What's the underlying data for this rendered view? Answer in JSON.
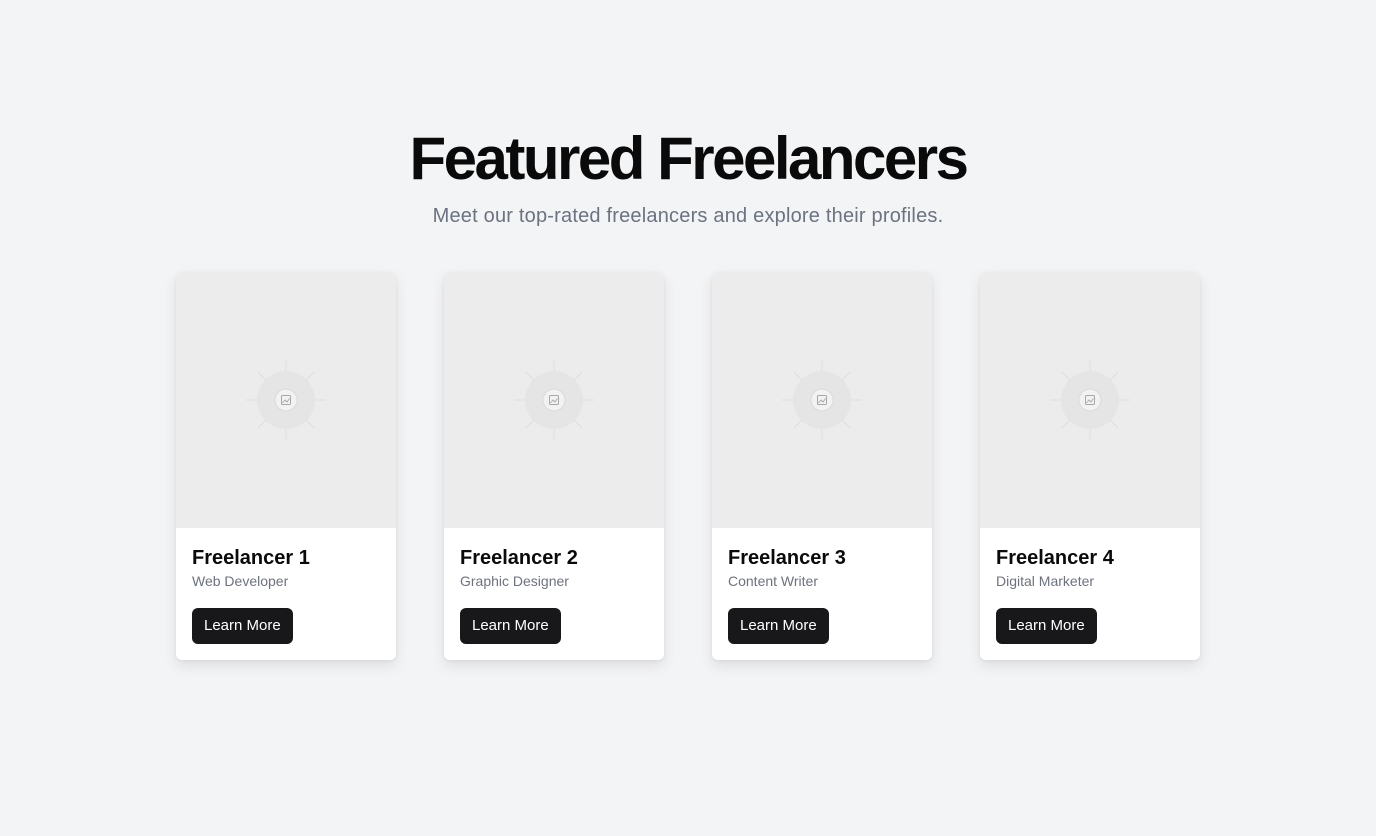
{
  "header": {
    "title": "Featured Freelancers",
    "subtitle": "Meet our top-rated freelancers and explore their profiles."
  },
  "freelancers": [
    {
      "name": "Freelancer 1",
      "role": "Web Developer",
      "button_label": "Learn More"
    },
    {
      "name": "Freelancer 2",
      "role": "Graphic Designer",
      "button_label": "Learn More"
    },
    {
      "name": "Freelancer 3",
      "role": "Content Writer",
      "button_label": "Learn More"
    },
    {
      "name": "Freelancer 4",
      "role": "Digital Marketer",
      "button_label": "Learn More"
    }
  ],
  "icons": {
    "card_image": "image-placeholder-icon"
  },
  "colors": {
    "background": "#f3f4f6",
    "button": "#18181b",
    "subtitle": "#6b7280"
  }
}
